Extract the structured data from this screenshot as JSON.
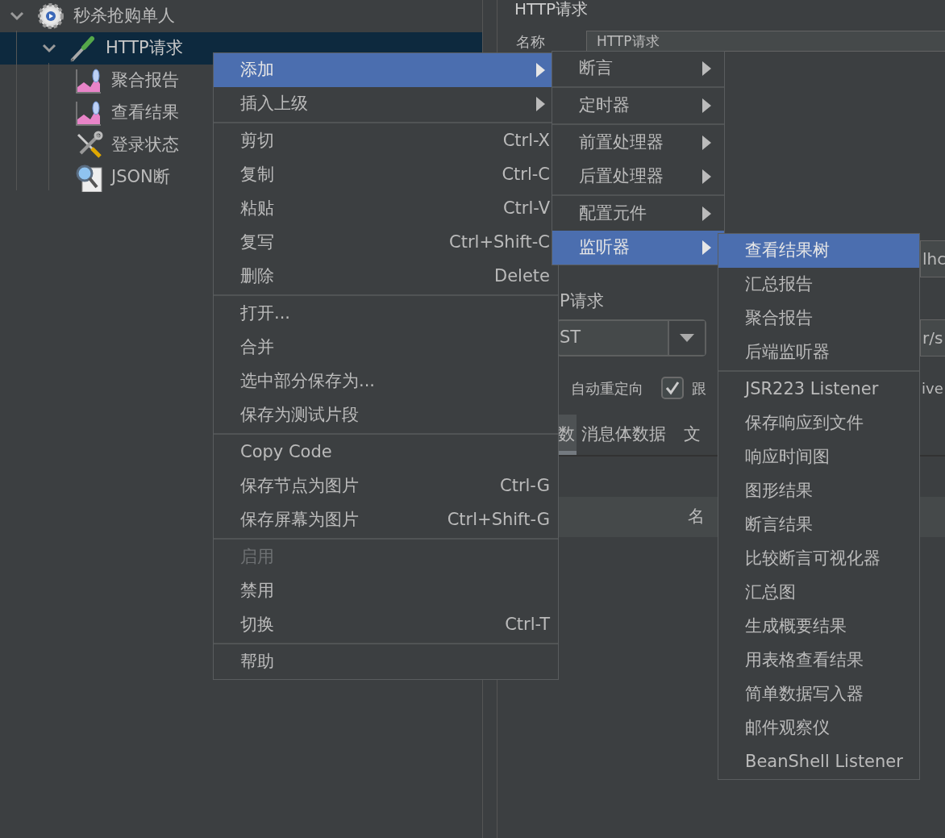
{
  "tree": [
    {
      "label": "秒杀抢购单人",
      "kind": "thread_group",
      "expanded": true,
      "selected": false,
      "children": [
        {
          "label": "HTTP请求",
          "kind": "sampler",
          "expanded": true,
          "selected": true,
          "children": [
            {
              "label": "聚合报告",
              "kind": "listener",
              "selected": false
            },
            {
              "label": "查看结果",
              "kind": "listener",
              "selected": false
            },
            {
              "label": "登录状态",
              "kind": "tool",
              "selected": false
            },
            {
              "label": "JSON断",
              "kind": "assertion",
              "selected": false
            }
          ]
        }
      ]
    }
  ],
  "editor": {
    "title": "HTTP请求",
    "name_label": "名称",
    "name_value": "HTTP请求",
    "server_field_fragment": "lhc",
    "group_title": "P请求",
    "method": "ST",
    "path_field_fragment": "r/s",
    "redirect_label": "自动重定向",
    "follow_checked": true,
    "follow_label": "跟",
    "keepalive_fragment": "ive",
    "tabs": [
      {
        "label": "数",
        "selected": true
      },
      {
        "label": "消息体数据",
        "selected": false
      },
      {
        "label": "文",
        "selected": false
      }
    ],
    "table_header": "名"
  },
  "context_menu": {
    "groups": [
      [
        {
          "label": "添加",
          "submenu": true,
          "selected": true,
          "disabled": false
        },
        {
          "label": "插入上级",
          "submenu": true,
          "selected": false,
          "disabled": false
        }
      ],
      [
        {
          "label": "剪切",
          "shortcut": "Ctrl-X",
          "submenu": false,
          "selected": false,
          "disabled": false
        },
        {
          "label": "复制",
          "shortcut": "Ctrl-C",
          "submenu": false,
          "selected": false,
          "disabled": false
        },
        {
          "label": "粘贴",
          "shortcut": "Ctrl-V",
          "submenu": false,
          "selected": false,
          "disabled": false
        },
        {
          "label": "复写",
          "shortcut": "Ctrl+Shift-C",
          "submenu": false,
          "selected": false,
          "disabled": false
        },
        {
          "label": "删除",
          "shortcut": "Delete",
          "submenu": false,
          "selected": false,
          "disabled": false
        }
      ],
      [
        {
          "label": "打开...",
          "submenu": false,
          "selected": false,
          "disabled": false
        },
        {
          "label": "合并",
          "submenu": false,
          "selected": false,
          "disabled": false
        },
        {
          "label": "选中部分保存为...",
          "submenu": false,
          "selected": false,
          "disabled": false
        },
        {
          "label": "保存为测试片段",
          "submenu": false,
          "selected": false,
          "disabled": false
        }
      ],
      [
        {
          "label": "Copy Code",
          "submenu": false,
          "selected": false,
          "disabled": false
        },
        {
          "label": "保存节点为图片",
          "shortcut": "Ctrl-G",
          "submenu": false,
          "selected": false,
          "disabled": false
        },
        {
          "label": "保存屏幕为图片",
          "shortcut": "Ctrl+Shift-G",
          "submenu": false,
          "selected": false,
          "disabled": false
        }
      ],
      [
        {
          "label": "启用",
          "submenu": false,
          "selected": false,
          "disabled": true
        },
        {
          "label": "禁用",
          "submenu": false,
          "selected": false,
          "disabled": false
        },
        {
          "label": "切换",
          "shortcut": "Ctrl-T",
          "submenu": false,
          "selected": false,
          "disabled": false
        }
      ],
      [
        {
          "label": "帮助",
          "submenu": false,
          "selected": false,
          "disabled": false
        }
      ]
    ]
  },
  "add_submenu": {
    "groups": [
      [
        {
          "label": "断言",
          "submenu": true,
          "selected": false,
          "disabled": false
        }
      ],
      [
        {
          "label": "定时器",
          "submenu": true,
          "selected": false,
          "disabled": false
        }
      ],
      [
        {
          "label": "前置处理器",
          "submenu": true,
          "selected": false,
          "disabled": false
        },
        {
          "label": "后置处理器",
          "submenu": true,
          "selected": false,
          "disabled": false
        }
      ],
      [
        {
          "label": "配置元件",
          "submenu": true,
          "selected": false,
          "disabled": false
        },
        {
          "label": "监听器",
          "submenu": true,
          "selected": true,
          "disabled": false
        }
      ]
    ]
  },
  "listener_submenu": {
    "groups": [
      [
        {
          "label": "查看结果树",
          "submenu": false,
          "selected": true,
          "disabled": false
        },
        {
          "label": "汇总报告",
          "submenu": false,
          "selected": false,
          "disabled": false
        },
        {
          "label": "聚合报告",
          "submenu": false,
          "selected": false,
          "disabled": false
        },
        {
          "label": "后端监听器",
          "submenu": false,
          "selected": false,
          "disabled": false
        }
      ],
      [
        {
          "label": "JSR223 Listener",
          "submenu": false,
          "selected": false,
          "disabled": false
        },
        {
          "label": "保存响应到文件",
          "submenu": false,
          "selected": false,
          "disabled": false
        },
        {
          "label": "响应时间图",
          "submenu": false,
          "selected": false,
          "disabled": false
        },
        {
          "label": "图形结果",
          "submenu": false,
          "selected": false,
          "disabled": false
        },
        {
          "label": "断言结果",
          "submenu": false,
          "selected": false,
          "disabled": false
        },
        {
          "label": "比较断言可视化器",
          "submenu": false,
          "selected": false,
          "disabled": false
        },
        {
          "label": "汇总图",
          "submenu": false,
          "selected": false,
          "disabled": false
        },
        {
          "label": "生成概要结果",
          "submenu": false,
          "selected": false,
          "disabled": false
        },
        {
          "label": "用表格查看结果",
          "submenu": false,
          "selected": false,
          "disabled": false
        },
        {
          "label": "简单数据写入器",
          "submenu": false,
          "selected": false,
          "disabled": false
        },
        {
          "label": "邮件观察仪",
          "submenu": false,
          "selected": false,
          "disabled": false
        },
        {
          "label": "BeanShell Listener",
          "submenu": false,
          "selected": false,
          "disabled": false
        }
      ]
    ]
  }
}
